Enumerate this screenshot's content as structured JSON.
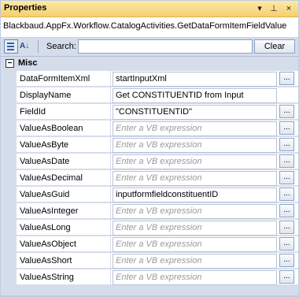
{
  "panel": {
    "title": "Properties",
    "pin_glyph": "⊥",
    "close_glyph": "×",
    "menu_glyph": "▾"
  },
  "type_name": "Blackbaud.AppFx.Workflow.CatalogActivities.GetDataFormItemFieldValue",
  "toolbar": {
    "alpha_glyph": "A↓",
    "search_label": "Search:",
    "search_value": "",
    "clear_label": "Clear"
  },
  "category": {
    "toggle": "−",
    "label": "Misc"
  },
  "properties": [
    {
      "name": "DataFormItemXml",
      "value": "startInputXml",
      "placeholder": false,
      "ellipsis": "..."
    },
    {
      "name": "DisplayName",
      "value": "Get CONSTITUENTID from Input",
      "placeholder": false,
      "ellipsis": ""
    },
    {
      "name": "FieldId",
      "value": "\"CONSTITUENTID\"",
      "placeholder": false,
      "ellipsis": "..."
    },
    {
      "name": "ValueAsBoolean",
      "value": "Enter a VB expression",
      "placeholder": true,
      "ellipsis": "..."
    },
    {
      "name": "ValueAsByte",
      "value": "Enter a VB expression",
      "placeholder": true,
      "ellipsis": "..."
    },
    {
      "name": "ValueAsDate",
      "value": "Enter a VB expression",
      "placeholder": true,
      "ellipsis": "..."
    },
    {
      "name": "ValueAsDecimal",
      "value": "Enter a VB expression",
      "placeholder": true,
      "ellipsis": "..."
    },
    {
      "name": "ValueAsGuid",
      "value": "inputformfieldconstituentID",
      "placeholder": false,
      "ellipsis": "..."
    },
    {
      "name": "ValueAsInteger",
      "value": "Enter a VB expression",
      "placeholder": true,
      "ellipsis": "..."
    },
    {
      "name": "ValueAsLong",
      "value": "Enter a VB expression",
      "placeholder": true,
      "ellipsis": "..."
    },
    {
      "name": "ValueAsObject",
      "value": "Enter a VB expression",
      "placeholder": true,
      "ellipsis": "..."
    },
    {
      "name": "ValueAsShort",
      "value": "Enter a VB expression",
      "placeholder": true,
      "ellipsis": "..."
    },
    {
      "name": "ValueAsString",
      "value": "Enter a VB expression",
      "placeholder": true,
      "ellipsis": "..."
    }
  ],
  "colors": {
    "title_bar": "#f6cf6e",
    "grid_gutter": "#d5ddeb",
    "placeholder_text": "#9a9a9a"
  }
}
